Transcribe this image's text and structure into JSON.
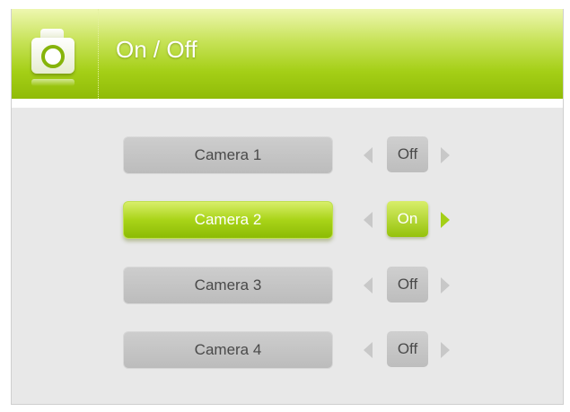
{
  "header": {
    "title": "On / Off",
    "icon": "camera-icon",
    "accent_color": "#a4cf16"
  },
  "cameras": [
    {
      "label": "Camera 1",
      "state": "Off",
      "selected": false
    },
    {
      "label": "Camera 2",
      "state": "On",
      "selected": true
    },
    {
      "label": "Camera 3",
      "state": "Off",
      "selected": false
    },
    {
      "label": "Camera 4",
      "state": "Off",
      "selected": false
    }
  ]
}
